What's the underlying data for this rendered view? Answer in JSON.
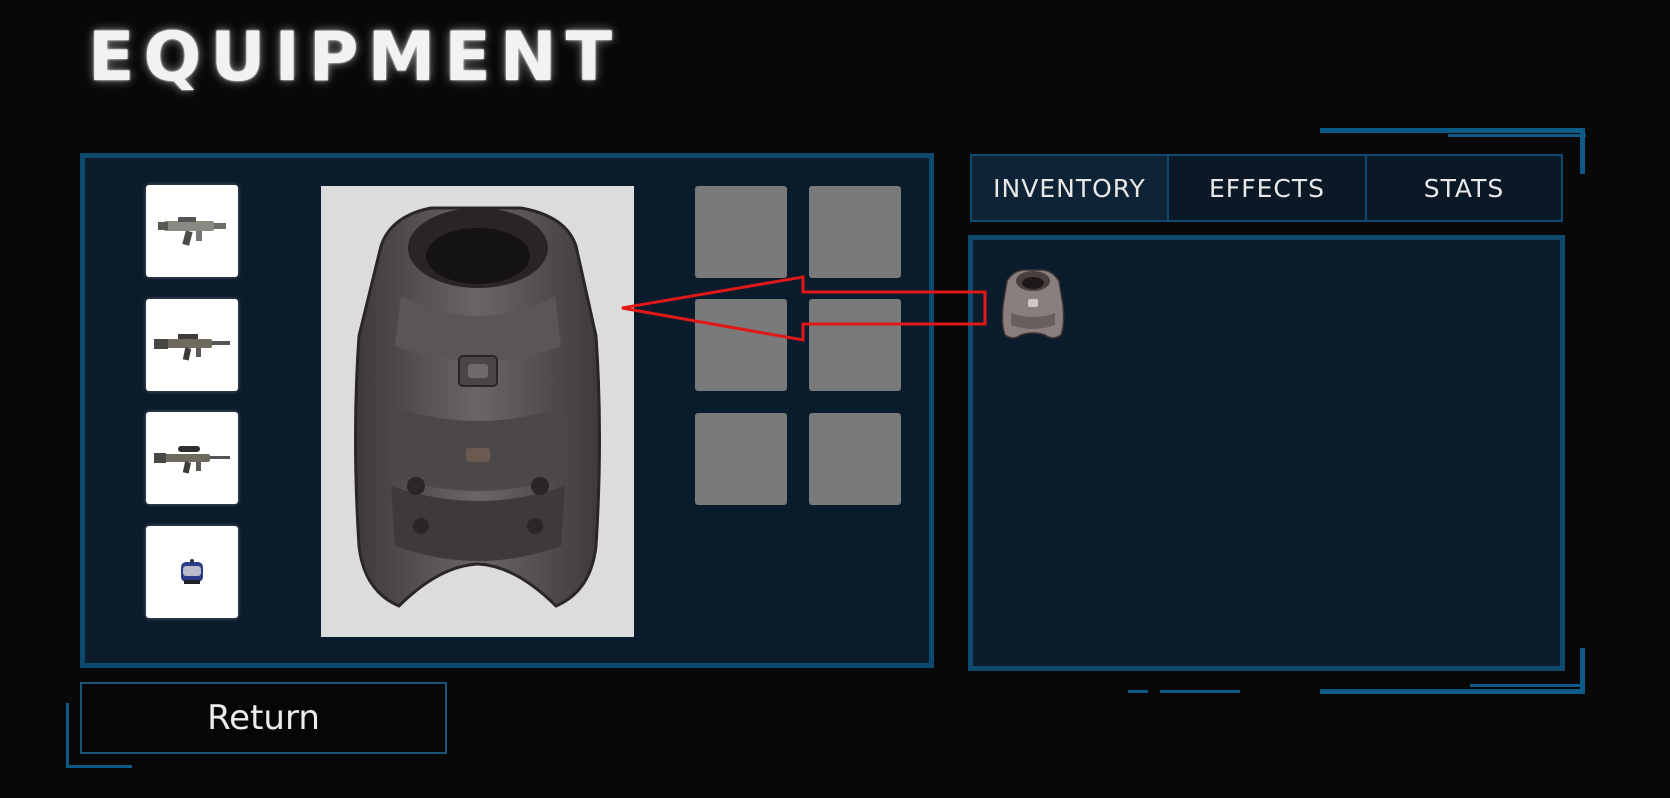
{
  "header": {
    "title": "EQUIPMENT"
  },
  "equipment": {
    "weapon_slots": [
      {
        "icon": "smg-weapon-icon"
      },
      {
        "icon": "assault-rifle-icon"
      },
      {
        "icon": "scoped-rifle-icon"
      },
      {
        "icon": "gadget-device-icon"
      }
    ],
    "preview_item": "armor-vest",
    "empty_slot_count": 6
  },
  "tabs": [
    {
      "label": "INVENTORY",
      "active": true
    },
    {
      "label": "EFFECTS",
      "active": false
    },
    {
      "label": "STATS",
      "active": false
    }
  ],
  "inventory": {
    "items": [
      {
        "icon": "armor-vest-icon"
      }
    ]
  },
  "annotation": {
    "color": "#e01818"
  },
  "footer": {
    "return_label": "Return"
  },
  "colors": {
    "panel_border": "#0e4a6e",
    "panel_bg": "#0a1b2b",
    "background": "#080808",
    "slot_white": "#ffffff",
    "slot_empty": "#7a7a7a"
  }
}
